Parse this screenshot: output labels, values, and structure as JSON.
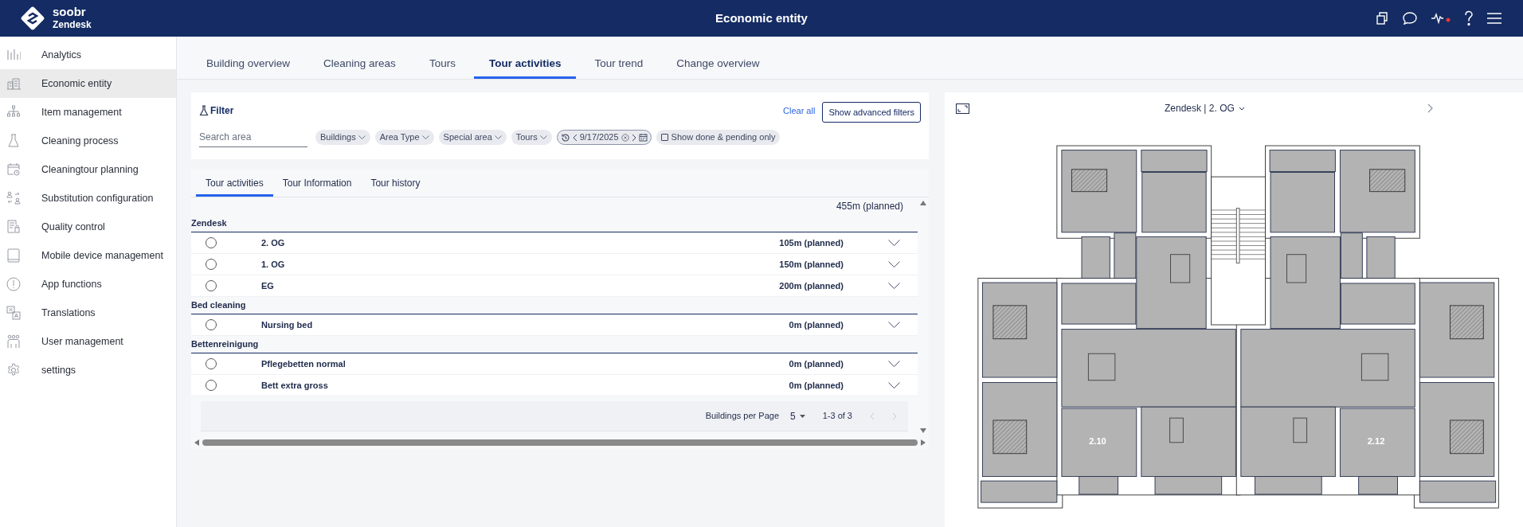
{
  "header": {
    "brand_name": "soobr",
    "brand_sub": "Zendesk",
    "title": "Economic entity"
  },
  "sidebar": {
    "items": [
      {
        "label": "Analytics",
        "selected": false
      },
      {
        "label": "Economic entity",
        "selected": true
      },
      {
        "label": "Item management",
        "selected": false
      },
      {
        "label": "Cleaning process",
        "selected": false
      },
      {
        "label": "Cleaningtour planning",
        "selected": false
      },
      {
        "label": "Substitution configuration",
        "selected": false
      },
      {
        "label": "Quality control",
        "selected": false
      },
      {
        "label": "Mobile device management",
        "selected": false
      },
      {
        "label": "App functions",
        "selected": false
      },
      {
        "label": "Translations",
        "selected": false
      },
      {
        "label": "User management",
        "selected": false
      },
      {
        "label": "settings",
        "selected": false
      }
    ]
  },
  "tabs": [
    {
      "label": "Building overview",
      "selected": false
    },
    {
      "label": "Cleaning areas",
      "selected": false
    },
    {
      "label": "Tours",
      "selected": false
    },
    {
      "label": "Tour activities",
      "selected": true
    },
    {
      "label": "Tour trend",
      "selected": false
    },
    {
      "label": "Change overview",
      "selected": false
    }
  ],
  "filter": {
    "title": "Filter",
    "clear_all": "Clear all",
    "advanced": "Show advanced filters",
    "search": {
      "placeholder": "Search area"
    },
    "chips": [
      "Buildings",
      "Area Type",
      "Special area",
      "Tours"
    ],
    "date": "9/17/2025",
    "done_pending": {
      "label": "Show done & pending only",
      "checked": false
    }
  },
  "subtabs": [
    {
      "label": "Tour activities",
      "selected": true
    },
    {
      "label": "Tour Information",
      "selected": false
    },
    {
      "label": "Tour history",
      "selected": false
    }
  ],
  "total": "455m (planned)",
  "groups": [
    {
      "name": "Zendesk",
      "rows": [
        {
          "name": "2. OG",
          "planned": "105m (planned)",
          "checked": false
        },
        {
          "name": "1. OG",
          "planned": "150m (planned)",
          "checked": false
        },
        {
          "name": "EG",
          "planned": "200m (planned)",
          "checked": false
        }
      ]
    },
    {
      "name": "Bed cleaning",
      "rows": [
        {
          "name": "Nursing bed",
          "planned": "0m (planned)",
          "checked": false
        }
      ]
    },
    {
      "name": "Bettenreinigung",
      "rows": [
        {
          "name": "Pflegebetten normal",
          "planned": "0m (planned)",
          "checked": false
        },
        {
          "name": "Bett extra gross",
          "planned": "0m (planned)",
          "checked": false
        }
      ]
    }
  ],
  "pagination": {
    "label": "Buildings per Page",
    "per_page": "5",
    "range": "1-3 of 3"
  },
  "plan": {
    "title": "Zendesk | 2. OG",
    "room_labels": [
      "2.10",
      "2.12"
    ]
  }
}
